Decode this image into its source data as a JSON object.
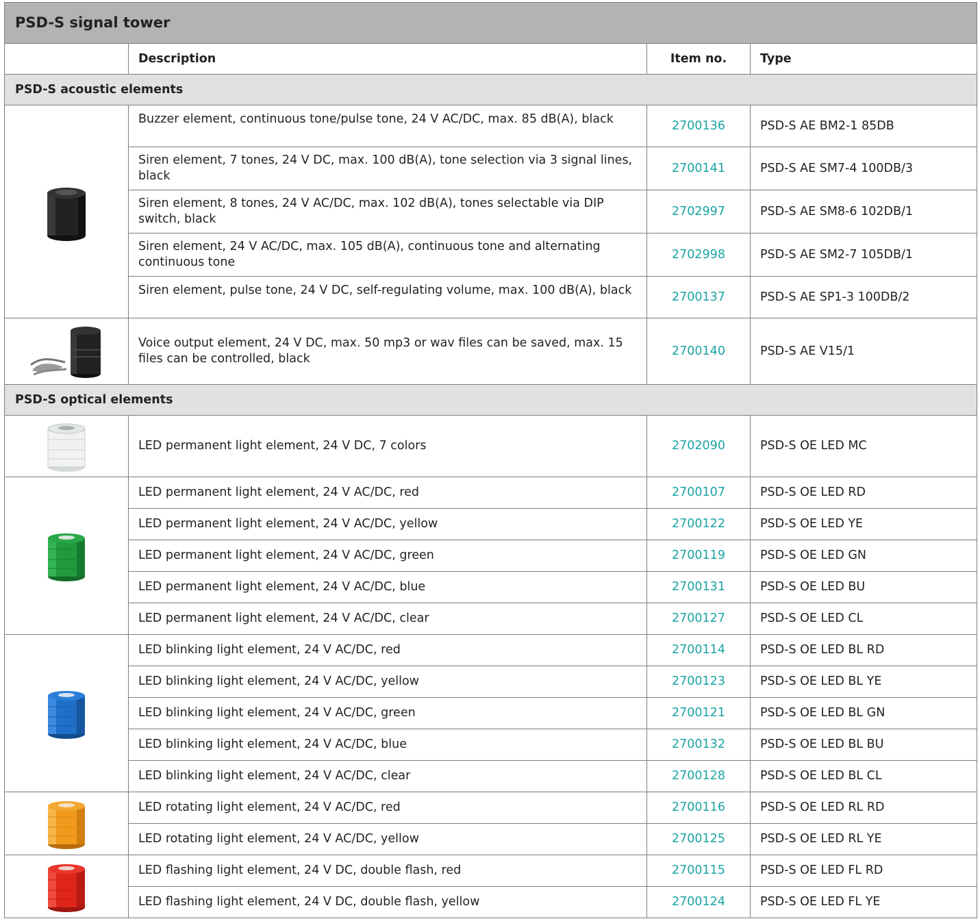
{
  "title": "PSD-S signal tower",
  "headers": {
    "image": "",
    "description": "Description",
    "item_no": "Item no.",
    "type": "Type"
  },
  "sections": [
    {
      "label": "PSD-S acoustic elements"
    },
    {
      "label": "PSD-S optical elements"
    }
  ],
  "rows": [
    {
      "description": "Buzzer element, continuous tone/pulse tone, 24 V AC/DC, max. 85 dB(A), black",
      "item_no": "2700136",
      "type": "PSD-S AE BM2-1 85DB"
    },
    {
      "description": "Siren element, 7 tones, 24 V DC, max. 100 dB(A), tone selection via 3 signal lines, black",
      "item_no": "2700141",
      "type": "PSD-S AE SM7-4 100DB/3"
    },
    {
      "description": "Siren element, 8 tones, 24 V AC/DC, max. 102 dB(A), tones selectable via DIP switch, black",
      "item_no": "2702997",
      "type": "PSD-S AE SM8-6 102DB/1"
    },
    {
      "description": "Siren element, 24 V AC/DC, max. 105 dB(A), continuous tone and alternating continuous tone",
      "item_no": "2702998",
      "type": "PSD-S AE SM2-7 105DB/1"
    },
    {
      "description": "Siren element, pulse tone, 24 V DC, self-regulating volume, max. 100 dB(A), black",
      "item_no": "2700137",
      "type": "PSD-S AE SP1-3 100DB/2"
    },
    {
      "description": "Voice output element, 24 V DC, max. 50 mp3 or wav files can be saved, max. 15 files can be controlled, black",
      "item_no": "2700140",
      "type": "PSD-S AE V15/1"
    },
    {
      "description": "LED permanent light element, 24 V DC, 7 colors",
      "item_no": "2702090",
      "type": "PSD-S OE LED MC"
    },
    {
      "description": "LED permanent light element, 24 V AC/DC, red",
      "item_no": "2700107",
      "type": "PSD-S OE LED RD"
    },
    {
      "description": "LED permanent light element, 24 V AC/DC, yellow",
      "item_no": "2700122",
      "type": "PSD-S OE LED YE"
    },
    {
      "description": "LED permanent light element, 24 V AC/DC, green",
      "item_no": "2700119",
      "type": "PSD-S OE LED GN"
    },
    {
      "description": "LED permanent light element, 24 V AC/DC, blue",
      "item_no": "2700131",
      "type": "PSD-S OE LED BU"
    },
    {
      "description": "LED permanent light element, 24 V AC/DC, clear",
      "item_no": "2700127",
      "type": "PSD-S OE LED CL"
    },
    {
      "description": "LED blinking light element, 24 V AC/DC, red",
      "item_no": "2700114",
      "type": "PSD-S OE LED BL RD"
    },
    {
      "description": "LED blinking light element, 24 V AC/DC, yellow",
      "item_no": "2700123",
      "type": "PSD-S OE LED BL YE"
    },
    {
      "description": "LED blinking light element, 24 V AC/DC, green",
      "item_no": "2700121",
      "type": "PSD-S OE LED BL GN"
    },
    {
      "description": "LED blinking light element, 24 V AC/DC, blue",
      "item_no": "2700132",
      "type": "PSD-S OE LED BL BU"
    },
    {
      "description": "LED blinking light element, 24 V AC/DC, clear",
      "item_no": "2700128",
      "type": "PSD-S OE LED BL CL"
    },
    {
      "description": "LED rotating light element, 24 V AC/DC, red",
      "item_no": "2700116",
      "type": "PSD-S OE LED RL RD"
    },
    {
      "description": "LED rotating light element, 24 V AC/DC, yellow",
      "item_no": "2700125",
      "type": "PSD-S OE LED RL YE"
    },
    {
      "description": "LED flashing light element, 24 V DC, double flash, red",
      "item_no": "2700115",
      "type": "PSD-S OE LED FL RD"
    },
    {
      "description": "LED flashing light element, 24 V DC, double flash, yellow",
      "item_no": "2700124",
      "type": "PSD-S OE LED FL YE"
    }
  ],
  "images": [
    {
      "icon": "black-buzzer-element-icon",
      "color": "#1e1e1e"
    },
    {
      "icon": "voice-output-element-icon",
      "color": "#1e1e1e"
    },
    {
      "icon": "clear-light-element-icon",
      "color": "#e8ecec"
    },
    {
      "icon": "green-light-element-icon",
      "color": "#1f9a3c"
    },
    {
      "icon": "blue-light-element-icon",
      "color": "#1f6ec8"
    },
    {
      "icon": "orange-light-element-icon",
      "color": "#f29a1c"
    },
    {
      "icon": "red-light-element-icon",
      "color": "#e0251b"
    }
  ],
  "colors": {
    "title_bg": "#b3b3b3",
    "section_bg": "#e1e1e1",
    "link": "#1aa3a3",
    "border": "#7d7d7d"
  }
}
